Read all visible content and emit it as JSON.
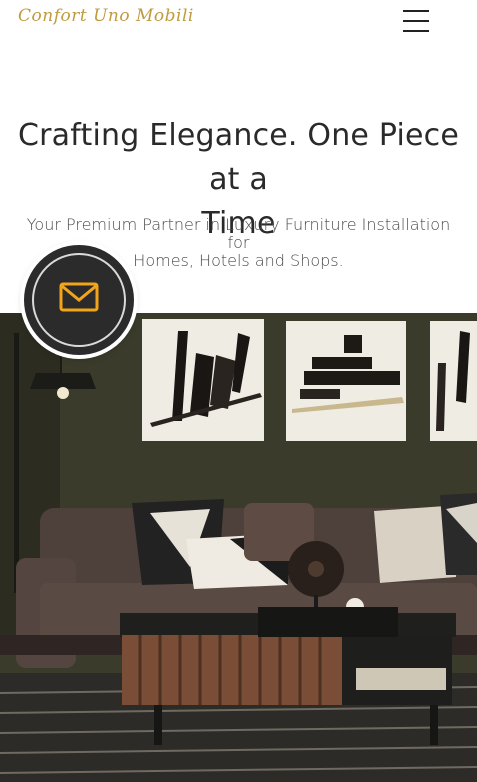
{
  "header": {
    "logo_text": "Confort Uno Mobili",
    "menu_icon": "hamburger-menu-icon"
  },
  "hero": {
    "title_line1": "Crafting Elegance. One Piece at a",
    "title_line2": "Time",
    "subtitle_line1": "Your Premium Partner in Luxury Furniture Installation for",
    "subtitle_line2": "Homes, Hotels and Shops."
  },
  "contact_fab": {
    "icon": "envelope-icon",
    "accent_color": "#f2a41a"
  },
  "colors": {
    "brand_gold": "#c19a3e",
    "text_dark": "#2a2a2a",
    "fab_background": "#2b2b2b"
  }
}
